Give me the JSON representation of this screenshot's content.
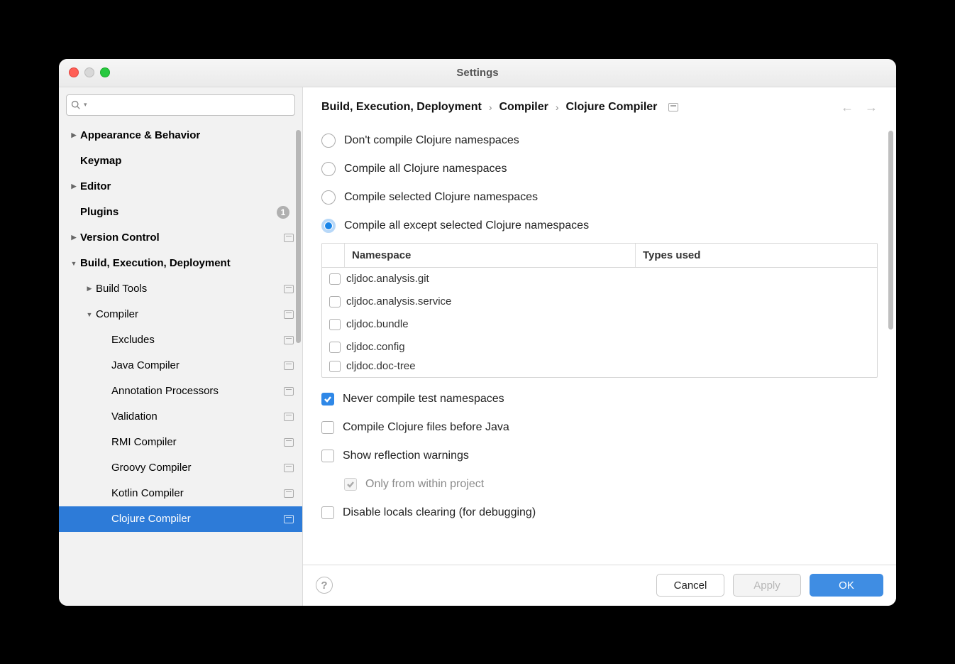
{
  "title": "Settings",
  "search_placeholder": "",
  "sidebar": [
    {
      "label": "Appearance & Behavior",
      "bold": true,
      "indent": 0,
      "arrow": "right",
      "proj": false
    },
    {
      "label": "Keymap",
      "bold": true,
      "indent": 0,
      "arrow": "",
      "proj": false
    },
    {
      "label": "Editor",
      "bold": true,
      "indent": 0,
      "arrow": "right",
      "proj": false
    },
    {
      "label": "Plugins",
      "bold": true,
      "indent": 0,
      "arrow": "",
      "proj": false,
      "badge": "1"
    },
    {
      "label": "Version Control",
      "bold": true,
      "indent": 0,
      "arrow": "right",
      "proj": true
    },
    {
      "label": "Build, Execution, Deployment",
      "bold": true,
      "indent": 0,
      "arrow": "down",
      "proj": false
    },
    {
      "label": "Build Tools",
      "bold": false,
      "indent": 1,
      "arrow": "right",
      "proj": true
    },
    {
      "label": "Compiler",
      "bold": false,
      "indent": 1,
      "arrow": "down",
      "proj": true
    },
    {
      "label": "Excludes",
      "bold": false,
      "indent": 2,
      "arrow": "",
      "proj": true
    },
    {
      "label": "Java Compiler",
      "bold": false,
      "indent": 2,
      "arrow": "",
      "proj": true
    },
    {
      "label": "Annotation Processors",
      "bold": false,
      "indent": 2,
      "arrow": "",
      "proj": true
    },
    {
      "label": "Validation",
      "bold": false,
      "indent": 2,
      "arrow": "",
      "proj": true
    },
    {
      "label": "RMI Compiler",
      "bold": false,
      "indent": 2,
      "arrow": "",
      "proj": true
    },
    {
      "label": "Groovy Compiler",
      "bold": false,
      "indent": 2,
      "arrow": "",
      "proj": true
    },
    {
      "label": "Kotlin Compiler",
      "bold": false,
      "indent": 2,
      "arrow": "",
      "proj": true
    },
    {
      "label": "Clojure Compiler",
      "bold": false,
      "indent": 2,
      "arrow": "",
      "proj": true,
      "selected": true
    }
  ],
  "breadcrumb": [
    "Build, Execution, Deployment",
    "Compiler",
    "Clojure Compiler"
  ],
  "radio_options": [
    "Don't compile Clojure namespaces",
    "Compile all Clojure namespaces",
    "Compile selected Clojure namespaces",
    "Compile all except selected Clojure namespaces"
  ],
  "radio_selected": 3,
  "ns_columns": {
    "c1": "Namespace",
    "c2": "Types used"
  },
  "ns_rows": [
    "cljdoc.analysis.git",
    "cljdoc.analysis.service",
    "cljdoc.bundle",
    "cljdoc.config",
    "cljdoc.doc-tree"
  ],
  "checks": {
    "never_test": {
      "label": "Never compile test namespaces",
      "checked": true
    },
    "before_java": {
      "label": "Compile Clojure files before Java",
      "checked": false
    },
    "reflection": {
      "label": "Show reflection warnings",
      "checked": false
    },
    "only_project": {
      "label": "Only from within project",
      "checked": true,
      "disabled": true
    },
    "disable_locals": {
      "label": "Disable locals clearing (for debugging)",
      "checked": false
    }
  },
  "buttons": {
    "cancel": "Cancel",
    "apply": "Apply",
    "ok": "OK"
  }
}
